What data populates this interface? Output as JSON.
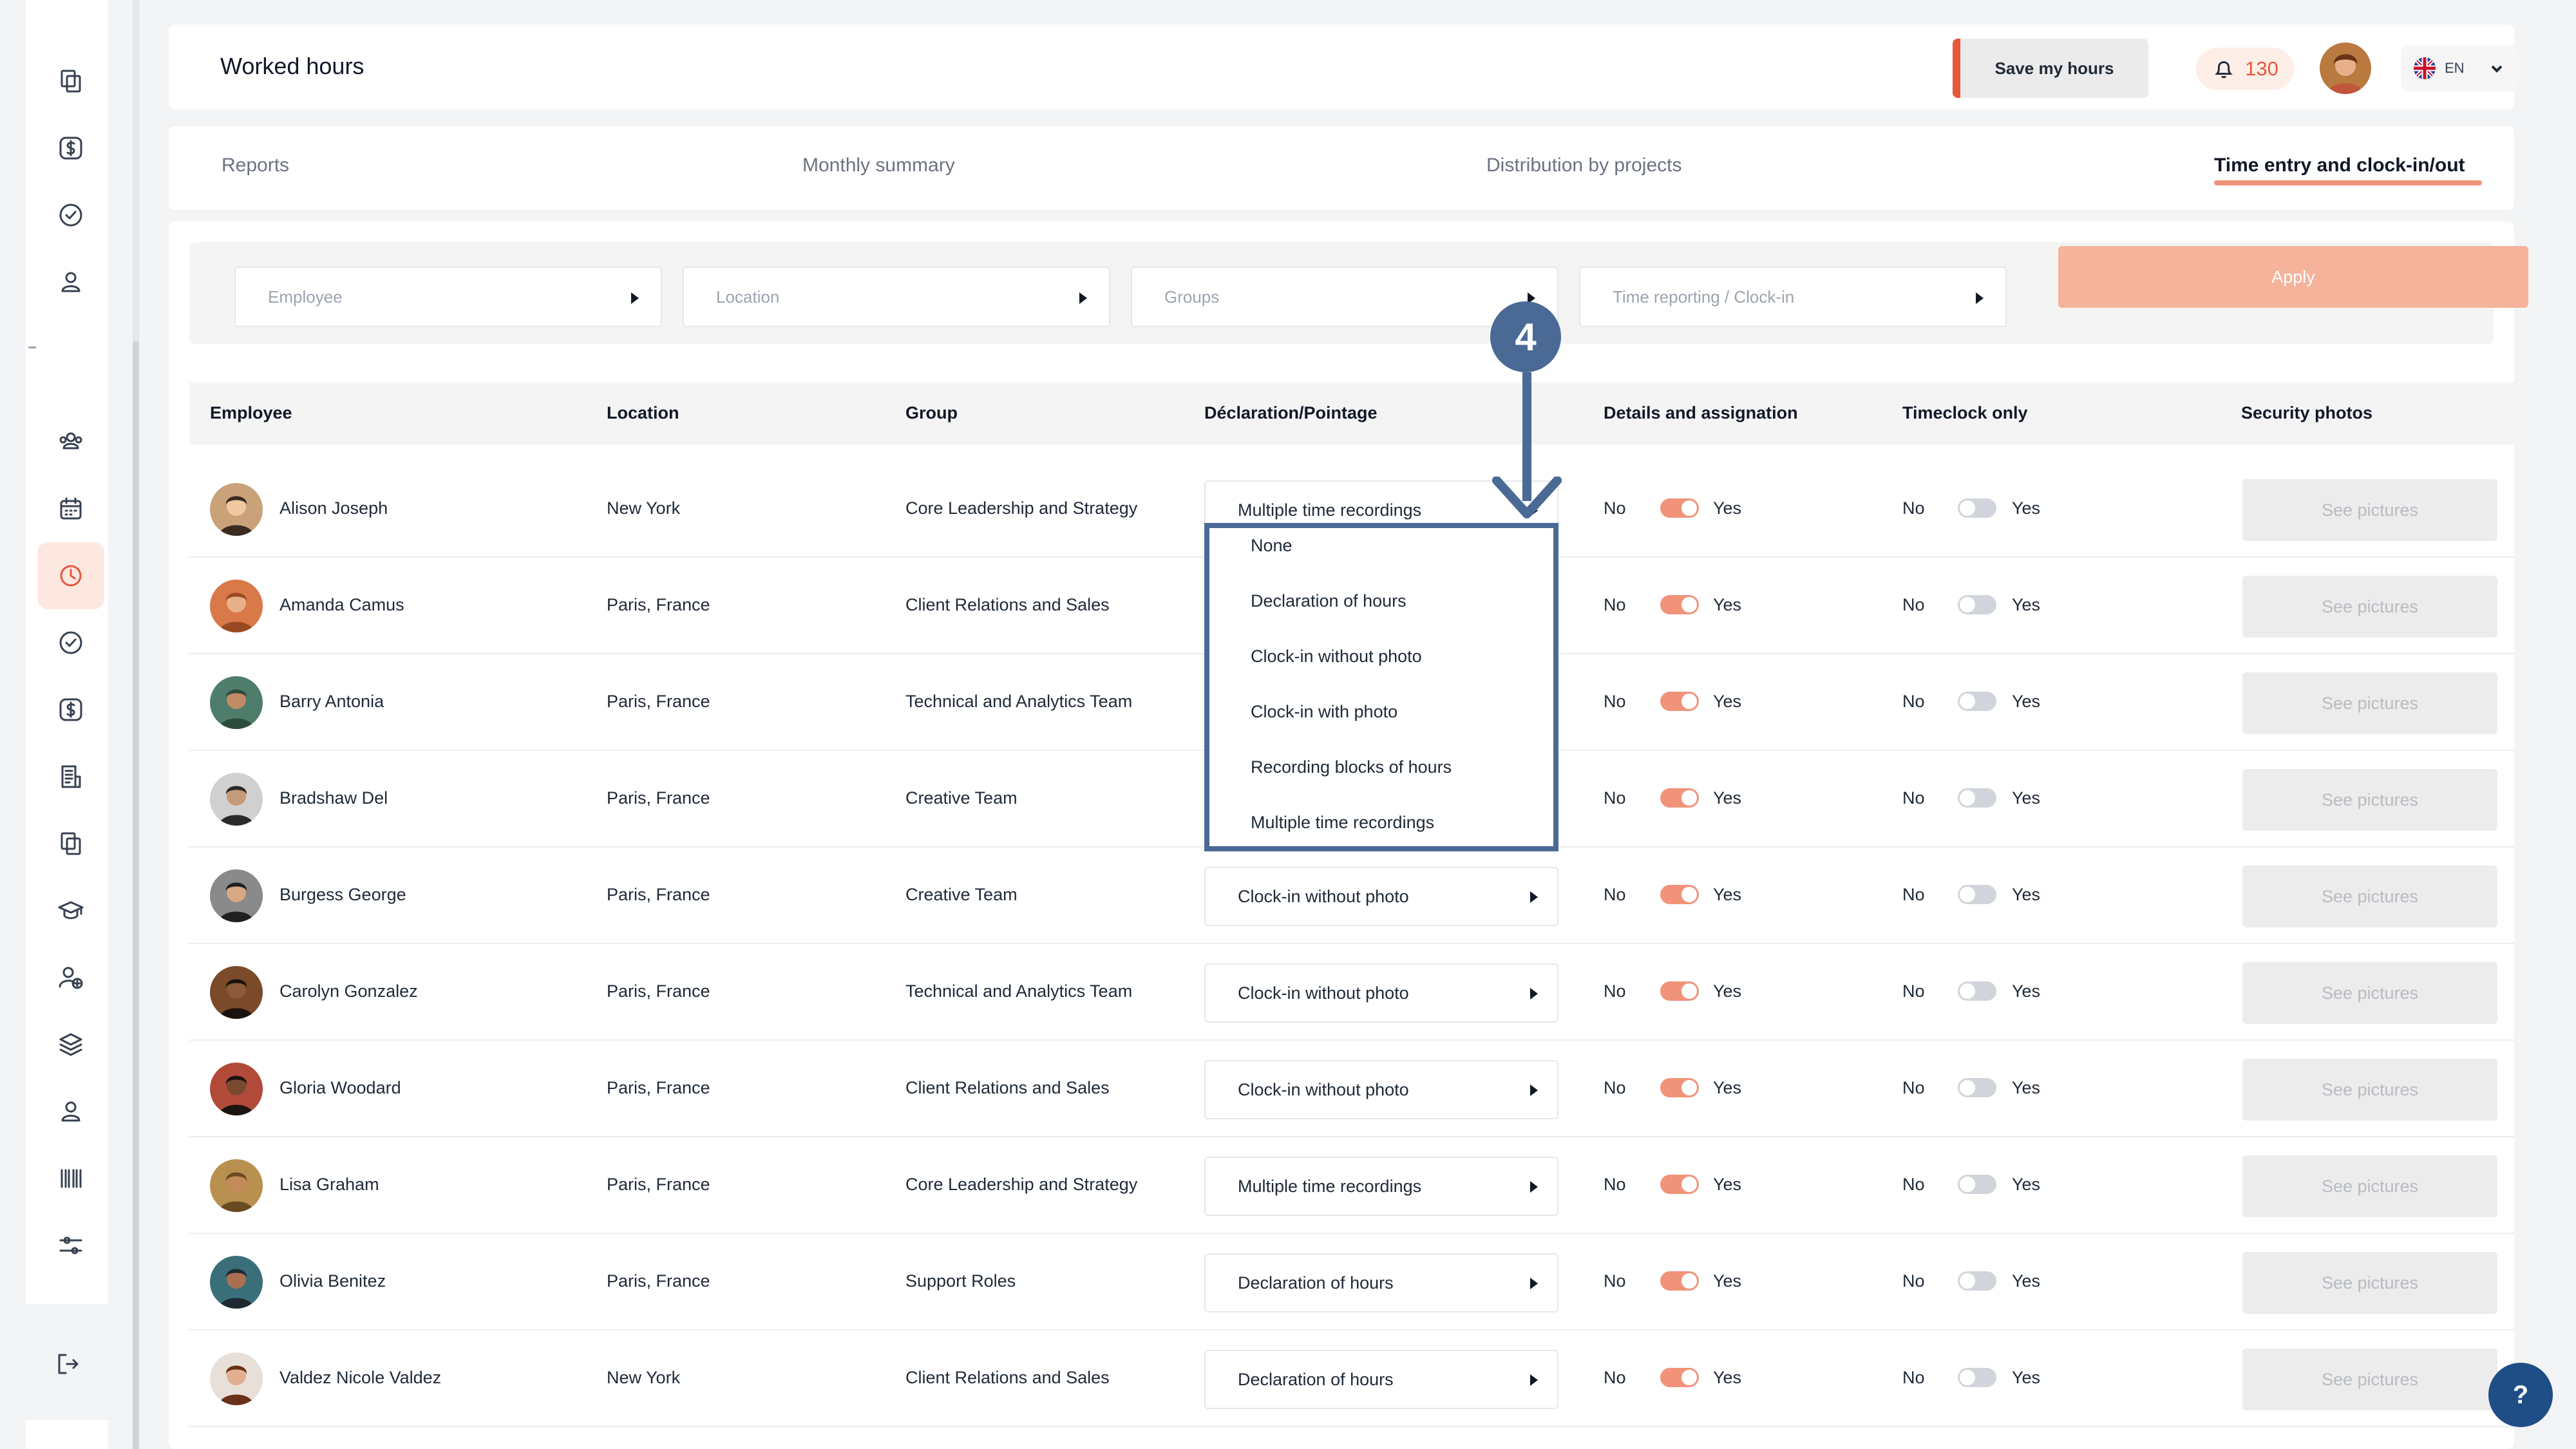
{
  "header": {
    "title": "Worked hours",
    "save_label": "Save my hours",
    "notification_count": "130",
    "language": "EN"
  },
  "tabs": [
    {
      "label": "Reports",
      "active": false
    },
    {
      "label": "Monthly summary",
      "active": false
    },
    {
      "label": "Distribution by projects",
      "active": false
    },
    {
      "label": "Time entry and clock-in/out",
      "active": true
    }
  ],
  "filters": {
    "employee_placeholder": "Employee",
    "location_placeholder": "Location",
    "groups_placeholder": "Groups",
    "time_reporting_placeholder": "Time reporting / Clock-in",
    "apply_label": "Apply"
  },
  "table": {
    "columns": [
      "Employee",
      "Location",
      "Group",
      "Déclaration/Pointage",
      "Details and assignation",
      "Timeclock only",
      "Security photos"
    ],
    "no_label": "No",
    "yes_label": "Yes",
    "see_pictures_label": "See pictures",
    "rows": [
      {
        "name": "Alison Joseph",
        "location": "New York",
        "group": "Core Leadership and Strategy",
        "declaration": "Multiple time recordings",
        "details_on": true,
        "timeclock_on": false
      },
      {
        "name": "Amanda Camus",
        "location": "Paris, France",
        "group": "Client Relations and Sales",
        "declaration": "",
        "details_on": true,
        "timeclock_on": false
      },
      {
        "name": "Barry Antonia",
        "location": "Paris, France",
        "group": "Technical and Analytics Team",
        "declaration": "",
        "details_on": true,
        "timeclock_on": false
      },
      {
        "name": "Bradshaw Del",
        "location": "Paris, France",
        "group": "Creative Team",
        "declaration": "",
        "details_on": true,
        "timeclock_on": false
      },
      {
        "name": "Burgess George",
        "location": "Paris, France",
        "group": "Creative Team",
        "declaration": "Clock-in without photo",
        "details_on": true,
        "timeclock_on": false
      },
      {
        "name": "Carolyn Gonzalez",
        "location": "Paris, France",
        "group": "Technical and Analytics Team",
        "declaration": "Clock-in without photo",
        "details_on": true,
        "timeclock_on": false
      },
      {
        "name": "Gloria Woodard",
        "location": "Paris, France",
        "group": "Client Relations and Sales",
        "declaration": "Clock-in without photo",
        "details_on": true,
        "timeclock_on": false
      },
      {
        "name": "Lisa Graham",
        "location": "Paris, France",
        "group": "Core Leadership and Strategy",
        "declaration": "Multiple time recordings",
        "details_on": true,
        "timeclock_on": false
      },
      {
        "name": "Olivia Benitez",
        "location": "Paris, France",
        "group": "Support Roles",
        "declaration": "Declaration of hours",
        "details_on": true,
        "timeclock_on": false
      },
      {
        "name": "Valdez Nicole Valdez",
        "location": "New York",
        "group": "Client Relations and Sales",
        "declaration": "Declaration of hours",
        "details_on": true,
        "timeclock_on": false
      }
    ]
  },
  "dropdown": {
    "options": [
      "None",
      "Declaration of hours",
      "Clock-in without photo",
      "Clock-in with photo",
      "Recording blocks of hours",
      "Multiple time recordings"
    ]
  },
  "annotation": {
    "step": "4"
  },
  "help_label": "?",
  "colors": {
    "accent": "#e8573a",
    "accent_light": "#f0937a",
    "apply_bg": "#f5b39b",
    "annotation": "#4a6a95",
    "help": "#1f4e87"
  },
  "icons": {
    "sidebar": [
      "copy-icon",
      "dollar-icon",
      "check-circle-icon",
      "user-icon",
      "team-icon",
      "calendar-icon",
      "clock-icon",
      "check-circle-icon",
      "dollar-icon",
      "report-icon",
      "copy-icon",
      "graduation-icon",
      "user-add-icon",
      "layers-icon",
      "user-icon",
      "barcode-icon",
      "sliders-icon",
      "logout-icon"
    ]
  }
}
